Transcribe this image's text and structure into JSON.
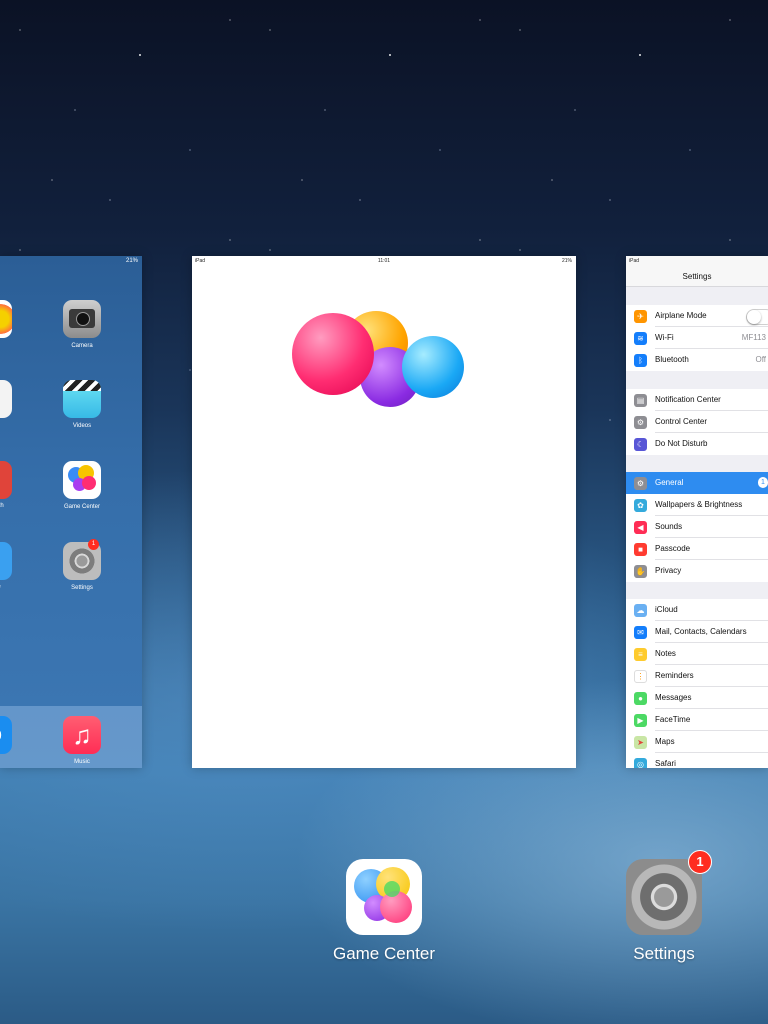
{
  "colors": {
    "accent": "#2e8cf0",
    "badge": "#ff2d20"
  },
  "home_card": {
    "status_battery": "21%",
    "apps": [
      {
        "label": "Camera",
        "icon": "camera-icon"
      },
      {
        "label": "Videos",
        "icon": "videos-icon"
      },
      {
        "label": "Game Center",
        "icon": "game-center-icon"
      },
      {
        "label": "Settings",
        "icon": "settings-icon",
        "badge": "1"
      },
      {
        "label": "Music",
        "icon": "music-icon"
      }
    ],
    "partial_labels": [
      "s",
      "",
      "ooth",
      "ore",
      ""
    ]
  },
  "gc_card": {
    "status_left": "iPad",
    "status_time": "11:01",
    "status_battery": "21%"
  },
  "settings_card": {
    "status_left": "iPad",
    "title": "Settings",
    "rows": [
      {
        "label": "Airplane Mode",
        "icon": "airplane-icon",
        "color": "#ff9500",
        "control": "toggle"
      },
      {
        "label": "Wi-Fi",
        "icon": "wifi-icon",
        "color": "#147efb",
        "value": "MF113"
      },
      {
        "label": "Bluetooth",
        "icon": "bluetooth-icon",
        "color": "#147efb",
        "value": "Off"
      },
      {
        "label": "Notification Center",
        "icon": "notification-center-icon",
        "color": "#8e8e93"
      },
      {
        "label": "Control Center",
        "icon": "control-center-icon",
        "color": "#8e8e93"
      },
      {
        "label": "Do Not Disturb",
        "icon": "moon-icon",
        "color": "#5856d6"
      },
      {
        "label": "General",
        "icon": "gear-icon",
        "color": "#8e8e93",
        "selected": true,
        "badge": "1"
      },
      {
        "label": "Wallpapers & Brightness",
        "icon": "wallpaper-icon",
        "color": "#34aadc"
      },
      {
        "label": "Sounds",
        "icon": "sounds-icon",
        "color": "#ff2d55"
      },
      {
        "label": "Passcode",
        "icon": "lock-icon",
        "color": "#ff3b30"
      },
      {
        "label": "Privacy",
        "icon": "hand-icon",
        "color": "#8e8e93"
      },
      {
        "label": "iCloud",
        "icon": "cloud-icon",
        "color": "#6ab0f2"
      },
      {
        "label": "Mail, Contacts, Calendars",
        "icon": "mail-icon",
        "color": "#147efb"
      },
      {
        "label": "Notes",
        "icon": "notes-icon",
        "color": "#fecb2e"
      },
      {
        "label": "Reminders",
        "icon": "reminders-icon",
        "color": "#ffffff"
      },
      {
        "label": "Messages",
        "icon": "messages-icon",
        "color": "#4cd964"
      },
      {
        "label": "FaceTime",
        "icon": "facetime-icon",
        "color": "#4cd964"
      },
      {
        "label": "Maps",
        "icon": "maps-icon",
        "color": "#c9e6a5"
      },
      {
        "label": "Safari",
        "icon": "safari-icon",
        "color": "#34aadc"
      }
    ]
  },
  "switcher_apps": [
    {
      "label": "Game Center",
      "icon": "game-center-icon"
    },
    {
      "label": "Settings",
      "icon": "settings-icon",
      "badge": "1"
    }
  ]
}
